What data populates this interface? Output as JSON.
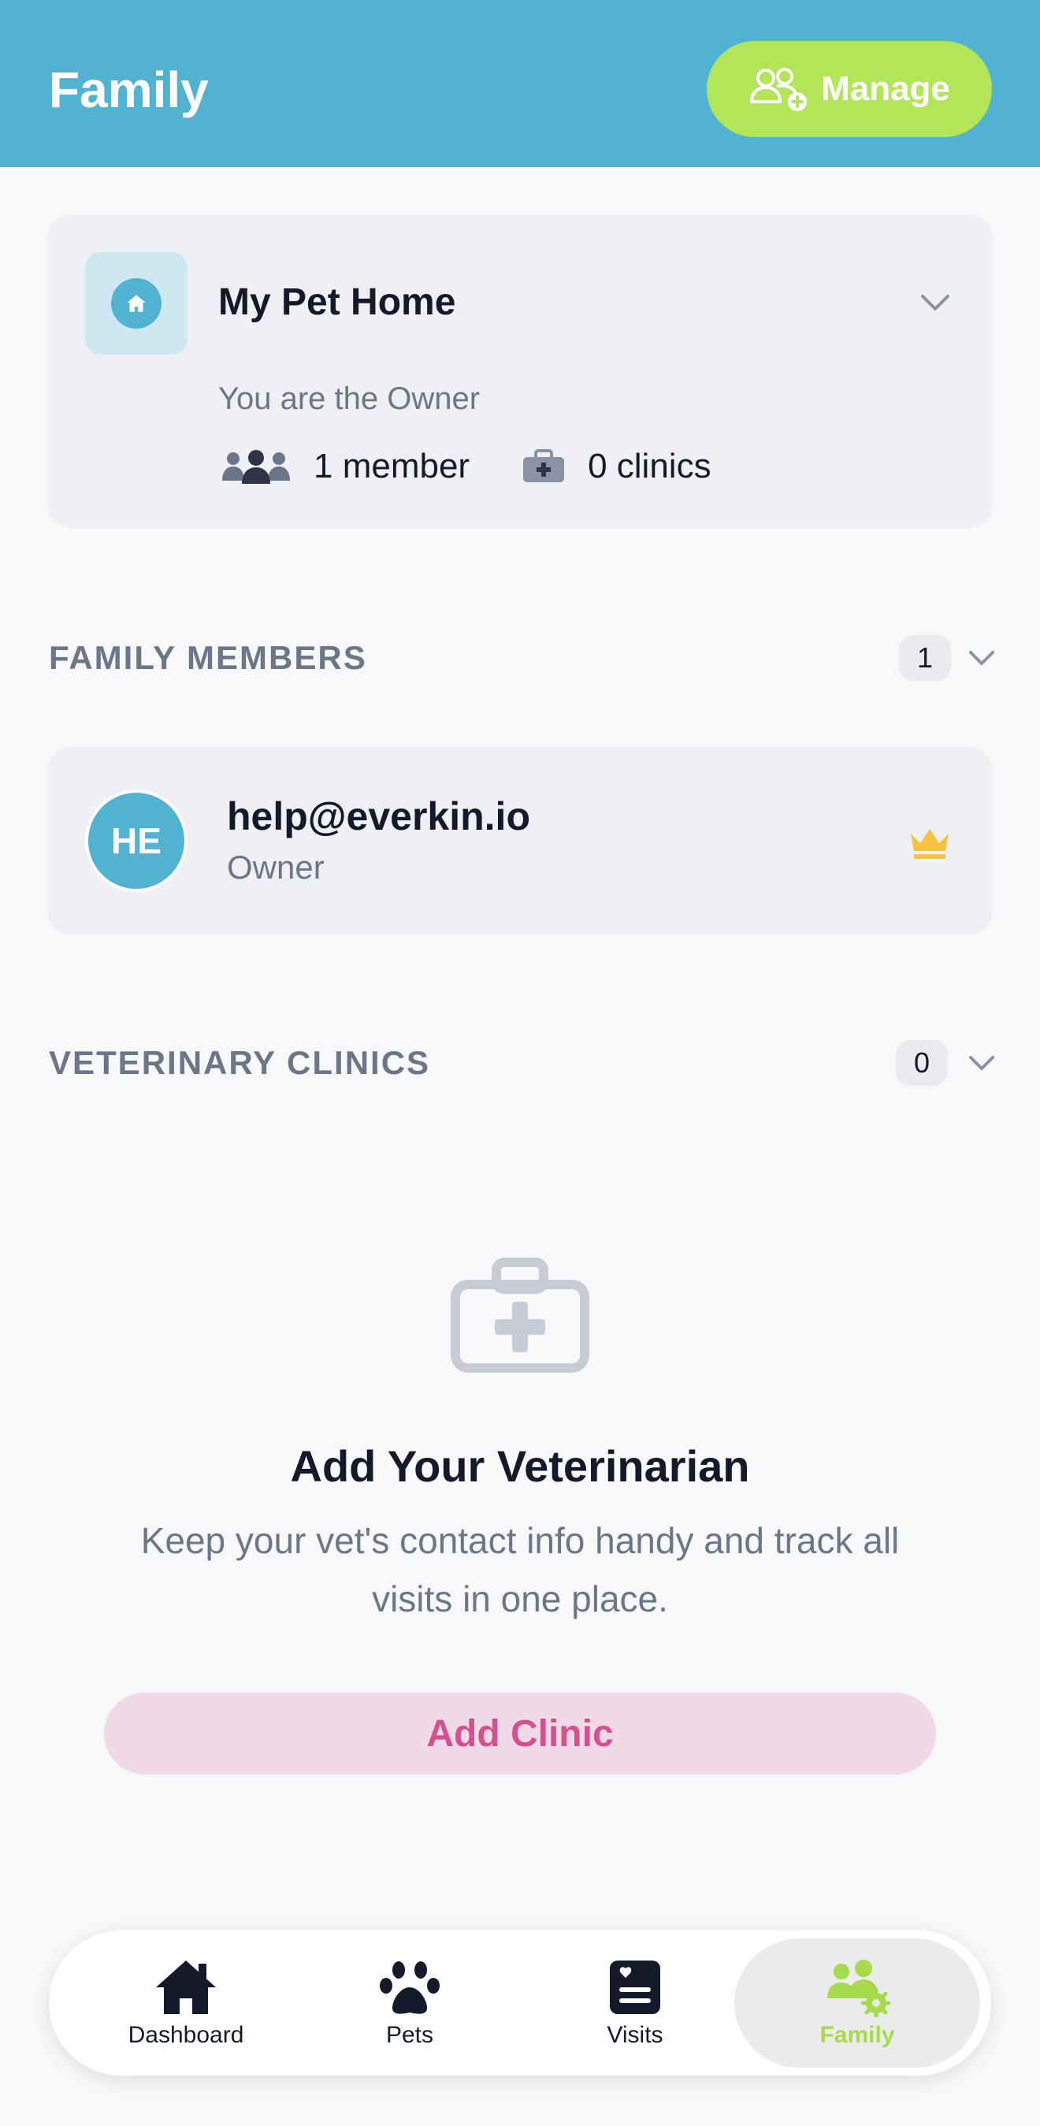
{
  "header": {
    "title": "Family",
    "manage_label": "Manage",
    "manage_icon": "users-plus-icon"
  },
  "home": {
    "name": "My Pet Home",
    "role_text": "You are the Owner",
    "members_text": "1 member",
    "clinics_text": "0 clinics",
    "icon": "house-icon"
  },
  "family_members": {
    "title": "FAMILY MEMBERS",
    "count": "1",
    "items": [
      {
        "initials": "HE",
        "email": "help@everkin.io",
        "role": "Owner",
        "badge_icon": "crown-icon"
      }
    ]
  },
  "clinics": {
    "title": "VETERINARY CLINICS",
    "count": "0",
    "empty_title": "Add Your Veterinarian",
    "empty_desc": "Keep your vet's contact info handy and track all visits in one place.",
    "add_label": "Add Clinic"
  },
  "nav": {
    "items": [
      {
        "label": "Dashboard",
        "icon": "house-icon"
      },
      {
        "label": "Pets",
        "icon": "paw-icon"
      },
      {
        "label": "Visits",
        "icon": "medical-record-icon"
      },
      {
        "label": "Family",
        "icon": "family-gear-icon"
      }
    ],
    "active": "Family"
  },
  "colors": {
    "header_bg": "#52b2d2",
    "accent_green": "#b2e558",
    "accent_pink": "#d64f8e",
    "crown_gold": "#f6c23b"
  }
}
